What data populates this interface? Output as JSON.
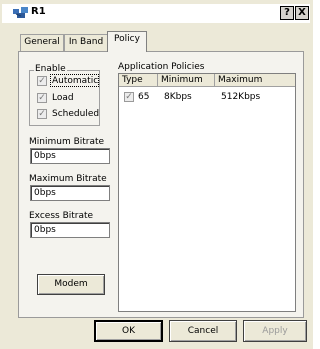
{
  "window": {
    "title": "R1",
    "help_label": "?",
    "close_label": "X"
  },
  "tabs": [
    {
      "label": "General",
      "active": false
    },
    {
      "label": "In Band",
      "active": false
    },
    {
      "label": "Policy",
      "active": true
    }
  ],
  "enable_group": {
    "label": "Enable",
    "items": [
      {
        "label": "Automatic",
        "checked": true,
        "disabled": true
      },
      {
        "label": "Load",
        "checked": true,
        "disabled": true
      },
      {
        "label": "Scheduled",
        "checked": true,
        "disabled": true
      }
    ]
  },
  "fields": {
    "min_bitrate": {
      "label": "Minimum Bitrate",
      "value": "0bps"
    },
    "max_bitrate": {
      "label": "Maximum Bitrate",
      "value": "0bps"
    },
    "excess_bitrate": {
      "label": "Excess Bitrate",
      "value": "0bps"
    }
  },
  "modem_button": "Modem",
  "app_policies": {
    "label": "Application Policies",
    "columns": [
      "Type",
      "Minimum",
      "Maximum"
    ],
    "rows": [
      {
        "checked": true,
        "type": "65",
        "minimum": "8Kbps",
        "maximum": "512Kbps"
      }
    ]
  },
  "footer": {
    "ok": "OK",
    "cancel": "Cancel",
    "apply": "Apply"
  },
  "colors": {
    "dialog_bg": "#ece9d8",
    "panel_bg": "#f4f3ee"
  }
}
